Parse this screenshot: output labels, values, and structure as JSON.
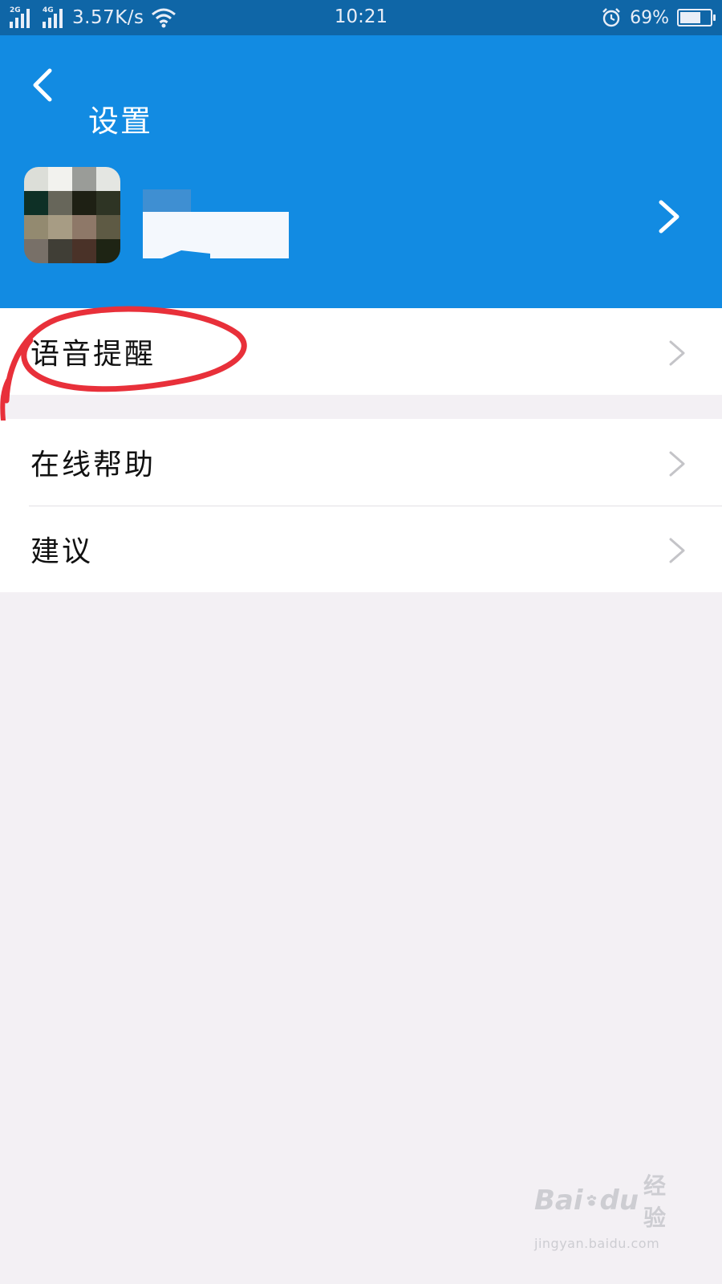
{
  "status_bar": {
    "net1_label": "2G",
    "net2_label": "4G",
    "speed": "3.57K/s",
    "time": "10:21",
    "battery_text": "69%",
    "battery_level": 0.69
  },
  "header": {
    "title": "设置",
    "back_icon": "chevron-left-icon",
    "profile_chevron_icon": "chevron-right-icon"
  },
  "settings": {
    "group1": [
      {
        "label": "语音提醒",
        "icon": "chevron-right-icon"
      }
    ],
    "group2": [
      {
        "label": "在线帮助",
        "icon": "chevron-right-icon"
      },
      {
        "label": "建议",
        "icon": "chevron-right-icon"
      }
    ]
  },
  "watermark": {
    "logo": "Bai  du 经验",
    "site": "jingyan.baidu.com"
  },
  "colors": {
    "status_bar": "#0f66a7",
    "header": "#128be2",
    "background": "#f3f0f4",
    "annotation": "#e8303a",
    "chevron": "#c4c4c8"
  }
}
